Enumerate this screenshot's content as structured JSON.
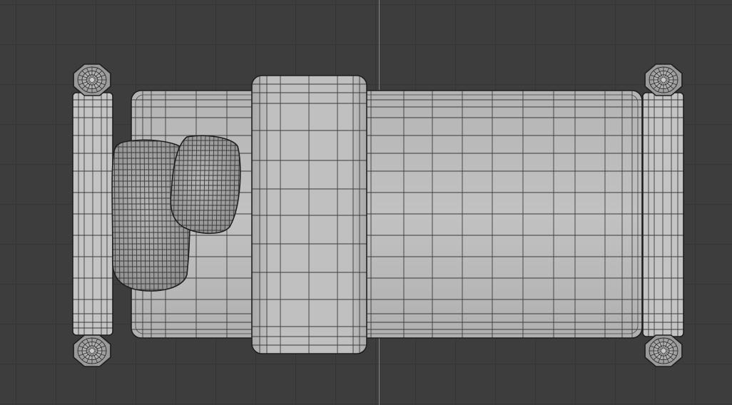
{
  "viewport": {
    "mode": "top-orthographic",
    "object": "bed-mesh",
    "shading": "solid-wireframe"
  },
  "colors": {
    "background": "#3d3d3d",
    "grid_line": "#353535",
    "y_axis": "#7a9a3c",
    "mesh_fill": "#bdbdbd",
    "mesh_wire": "#3a3a3a",
    "mesh_outline": "#1f1f1f"
  },
  "parts": [
    "headboard",
    "footboard",
    "mattress",
    "blanket",
    "pillow-left",
    "pillow-right",
    "bedpost-top-left",
    "bedpost-bottom-left",
    "bedpost-top-right",
    "bedpost-bottom-right"
  ]
}
